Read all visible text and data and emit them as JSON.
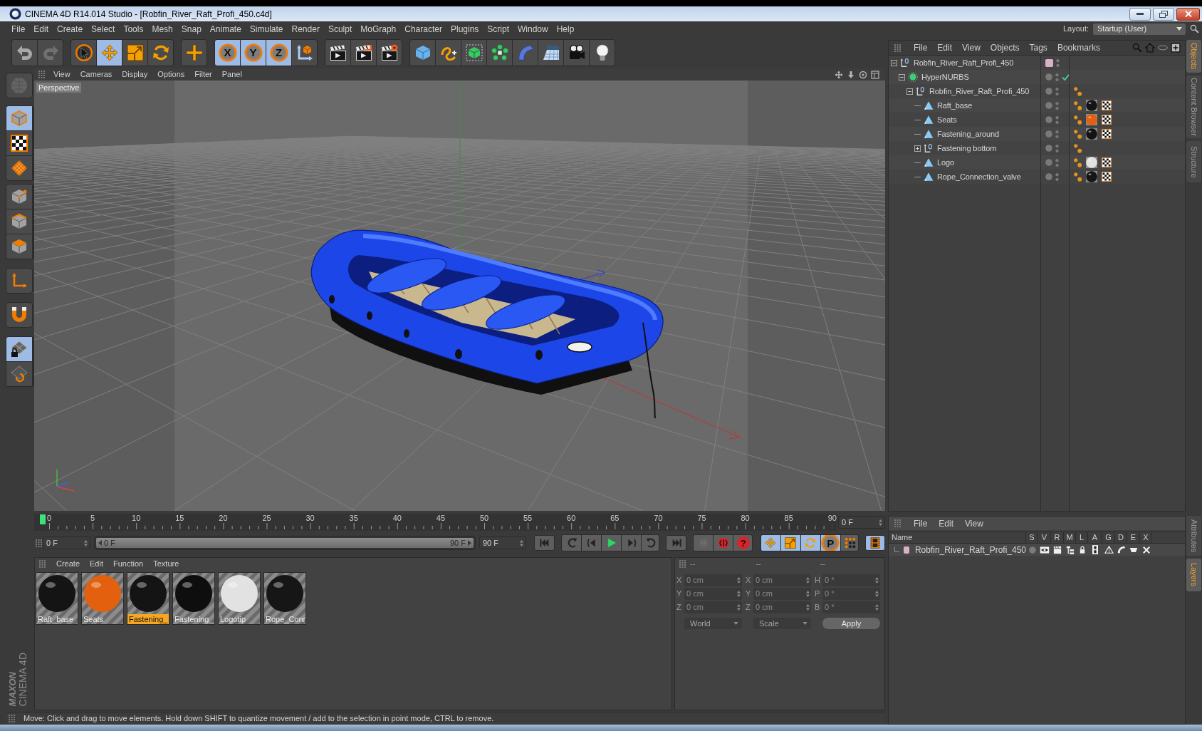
{
  "window": {
    "title": "CINEMA 4D R14.014 Studio - [Robfin_River_Raft_Profi_450.c4d]"
  },
  "menu_bar": {
    "items": [
      "File",
      "Edit",
      "Create",
      "Select",
      "Tools",
      "Mesh",
      "Snap",
      "Animate",
      "Simulate",
      "Render",
      "Sculpt",
      "MoGraph",
      "Character",
      "Plugins",
      "Script",
      "Window",
      "Help"
    ],
    "layout_label": "Layout:",
    "layout_value": "Startup (User)"
  },
  "toolbar": {
    "history": [
      {
        "disabled": false
      },
      {
        "disabled": true
      }
    ],
    "tools": [
      {
        "selected": false
      },
      {
        "selected": true
      },
      {
        "selected": false
      },
      {
        "selected": false
      }
    ],
    "axis_locks": [
      {
        "label": "X",
        "selected": true
      },
      {
        "label": "Y",
        "selected": true
      },
      {
        "label": "Z",
        "selected": true
      }
    ]
  },
  "left_toolbar": {
    "make_editable": {
      "disabled": true
    },
    "groups": [
      {
        "buttons": [
          {
            "selected": true
          },
          {
            "selected": false
          },
          {
            "selected": false
          }
        ]
      },
      {
        "buttons": [
          {
            "selected": false
          },
          {
            "selected": false
          },
          {
            "selected": false
          }
        ]
      },
      {
        "buttons": [
          {
            "selected": false
          }
        ]
      },
      {
        "buttons": [
          {
            "selected": false
          }
        ]
      },
      {
        "buttons": [
          {
            "selected": true
          },
          {
            "selected": false
          }
        ]
      }
    ]
  },
  "logo": {
    "brand": "MAXON",
    "product": "CINEMA 4D"
  },
  "viewport": {
    "menu": [
      "View",
      "Cameras",
      "Display",
      "Options",
      "Filter",
      "Panel"
    ],
    "camera": "Perspective"
  },
  "timeline": {
    "ticks": [
      "0",
      "5",
      "10",
      "15",
      "20",
      "25",
      "30",
      "35",
      "40",
      "45",
      "50",
      "55",
      "60",
      "65",
      "70",
      "75",
      "80",
      "85",
      "90"
    ],
    "level": 0,
    "frame_field": "0 F",
    "start_field": "0 F",
    "range_slider": {
      "start": "0 F",
      "end": "90 F",
      "level": 1
    },
    "end_field": "90 F",
    "key_buttons": [
      {
        "disabled": true
      },
      {
        "disabled": false
      },
      {
        "disabled": false,
        "label": "?"
      }
    ],
    "key_filters": [
      {
        "selected": true
      },
      {
        "selected": true
      },
      {
        "selected": true
      },
      {
        "selected": true,
        "label": "P"
      },
      {
        "selected": false
      }
    ],
    "timeline_button": {
      "selected": true
    }
  },
  "material_manager": {
    "menu": [
      "Create",
      "Edit",
      "Function",
      "Texture"
    ],
    "materials": [
      {
        "name": "Raft_base",
        "selected": false,
        "color": "#141414"
      },
      {
        "name": "Seats",
        "selected": false,
        "color": "#e2600e"
      },
      {
        "name": "Fastening_",
        "selected": true,
        "color": "#141414"
      },
      {
        "name": "Fastening_",
        "selected": false,
        "color": "#0e0e0e"
      },
      {
        "name": "Logotip",
        "selected": false,
        "color": "#e2e2e2"
      },
      {
        "name": "Rope_Conr",
        "selected": false,
        "color": "#161616"
      }
    ]
  },
  "coordinates": {
    "disabled": true,
    "columns": [
      {
        "header": "--",
        "fields": [
          {
            "axis": "X",
            "value": "0 cm"
          },
          {
            "axis": "Y",
            "value": "0 cm"
          },
          {
            "axis": "Z",
            "value": "0 cm"
          }
        ]
      },
      {
        "header": "--",
        "fields": [
          {
            "axis": "X",
            "value": "0 cm"
          },
          {
            "axis": "Y",
            "value": "0 cm"
          },
          {
            "axis": "Z",
            "value": "0 cm"
          }
        ]
      },
      {
        "header": "--",
        "fields": [
          {
            "axis": "H",
            "value": "0 °"
          },
          {
            "axis": "P",
            "value": "0 °"
          },
          {
            "axis": "B",
            "value": "0 °"
          }
        ]
      }
    ],
    "dropdowns": [
      "World",
      "Scale"
    ],
    "apply": "Apply"
  },
  "status_bar": {
    "text": "Move: Click and drag to move elements. Hold down SHIFT to quantize movement / add to the selection in point mode, CTRL to remove."
  },
  "object_manager": {
    "menu": [
      "File",
      "Edit",
      "View",
      "Objects",
      "Tags",
      "Bookmarks"
    ],
    "objects": [
      {
        "name": "Robfin_River_Raft_Profi_450",
        "kind": "null",
        "expanded": true,
        "color": "#d8b0c8",
        "children": [
          {
            "name": "HyperNURBS",
            "kind": "hypernurbs",
            "expanded": true,
            "enabled": true,
            "children": [
              {
                "name": "Robfin_River_Raft_Profi_450",
                "kind": "null",
                "expanded": true,
                "tags": [
                  {
                    "kind": "phong"
                  }
                ],
                "children": [
                  {
                    "name": "Raft_base",
                    "kind": "polygon",
                    "tags": [
                      {
                        "kind": "phong"
                      },
                      {
                        "kind": "material",
                        "color": "#141414"
                      },
                      {
                        "kind": "uvw"
                      }
                    ]
                  },
                  {
                    "name": "Seats",
                    "kind": "polygon",
                    "tags": [
                      {
                        "kind": "phong"
                      },
                      {
                        "kind": "material",
                        "color": "#e2600e"
                      },
                      {
                        "kind": "uvw"
                      }
                    ]
                  },
                  {
                    "name": "Fastening_around",
                    "kind": "polygon",
                    "tags": [
                      {
                        "kind": "phong"
                      },
                      {
                        "kind": "material",
                        "color": "#141414"
                      },
                      {
                        "kind": "uvw"
                      }
                    ]
                  },
                  {
                    "name": "Fastening bottom",
                    "kind": "null",
                    "expanded": false,
                    "tags": [
                      {
                        "kind": "phong"
                      }
                    ]
                  },
                  {
                    "name": "Logo",
                    "kind": "polygon",
                    "tags": [
                      {
                        "kind": "phong"
                      },
                      {
                        "kind": "material",
                        "color": "#e2e2e2"
                      },
                      {
                        "kind": "uvw"
                      }
                    ]
                  },
                  {
                    "name": "Rope_Connection_valve",
                    "kind": "polygon",
                    "tags": [
                      {
                        "kind": "phong"
                      },
                      {
                        "kind": "material",
                        "color": "#161616"
                      },
                      {
                        "kind": "uvw"
                      }
                    ]
                  }
                ]
              }
            ]
          }
        ]
      }
    ]
  },
  "layer_manager": {
    "menu": [
      "File",
      "Edit",
      "View"
    ],
    "columns": [
      "Name",
      "S",
      "V",
      "R",
      "M",
      "L",
      "A",
      "G",
      "D",
      "E",
      "X"
    ],
    "layers": [
      {
        "name": "Robfin_River_Raft_Profi_450",
        "color": "#d8b0c8",
        "toggles": [
          {
            "on": false
          },
          {
            "on": true
          },
          {
            "on": true
          },
          {
            "on": true
          },
          {
            "on": true
          },
          {
            "on": true
          },
          {
            "on": true
          },
          {
            "on": true
          },
          {
            "on": true
          },
          {
            "on": true
          }
        ]
      }
    ]
  },
  "side_tabs_top": [
    {
      "label": "Objects",
      "selected": true
    },
    {
      "label": "Content Browser",
      "selected": false
    },
    {
      "label": "Structure",
      "selected": false
    }
  ],
  "side_tabs_bottom": [
    {
      "label": "Attributes",
      "selected": false
    },
    {
      "label": "Layers",
      "selected": true
    }
  ]
}
